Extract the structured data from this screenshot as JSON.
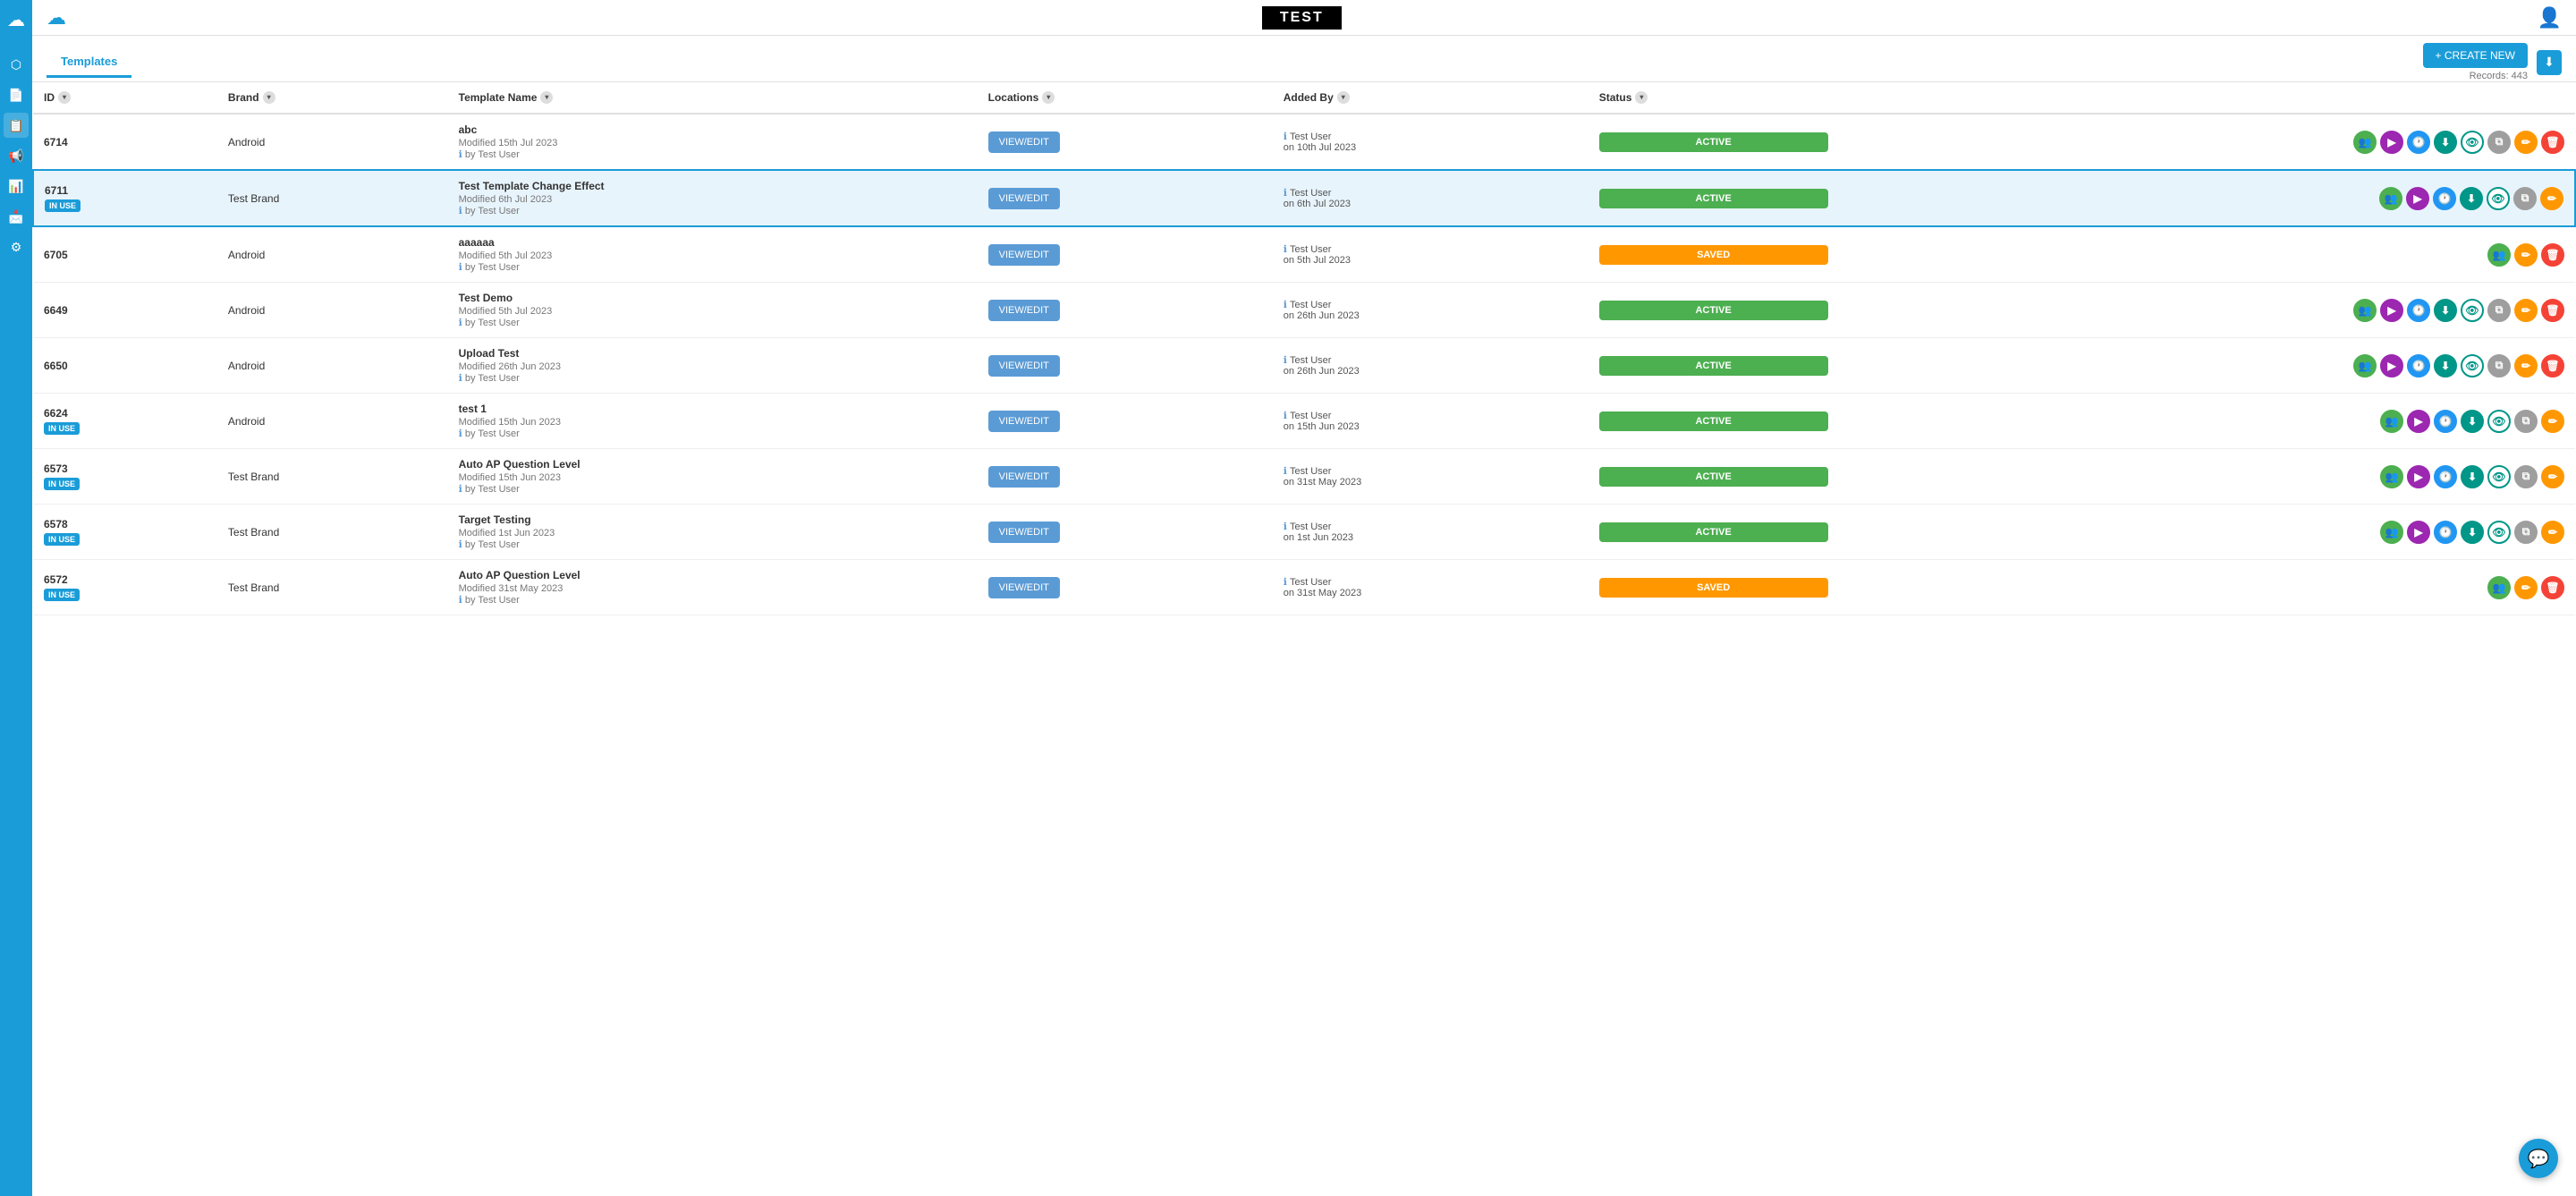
{
  "header": {
    "title": "TEST",
    "user_icon": "👤"
  },
  "tabs": {
    "active": "Templates",
    "items": [
      "Templates"
    ]
  },
  "toolbar": {
    "create_new_label": "+ CREATE NEW",
    "records_label": "Records: 443"
  },
  "table": {
    "columns": [
      {
        "label": "ID",
        "key": "id"
      },
      {
        "label": "Brand",
        "key": "brand"
      },
      {
        "label": "Template Name",
        "key": "template_name"
      },
      {
        "label": "Locations",
        "key": "locations"
      },
      {
        "label": "Added By",
        "key": "added_by"
      },
      {
        "label": "Status",
        "key": "status"
      }
    ],
    "rows": [
      {
        "id": "6714",
        "in_use": false,
        "brand": "Android",
        "template_name": "abc",
        "modified": "Modified 15th Jul 2023",
        "by": "by Test User",
        "added_by_user": "Test User",
        "added_on": "on 10th Jul 2023",
        "status": "ACTIVE",
        "highlighted": false,
        "actions": [
          "group",
          "play",
          "clock",
          "download",
          "eye",
          "copy",
          "edit",
          "delete"
        ]
      },
      {
        "id": "6711",
        "in_use": true,
        "brand": "Test Brand",
        "template_name": "Test Template Change Effect",
        "modified": "Modified 6th Jul 2023",
        "by": "by Test User",
        "added_by_user": "Test User",
        "added_on": "on 6th Jul 2023",
        "status": "ACTIVE",
        "highlighted": true,
        "actions": [
          "group",
          "play",
          "clock",
          "download",
          "eye",
          "copy",
          "edit"
        ]
      },
      {
        "id": "6705",
        "in_use": false,
        "brand": "Android",
        "template_name": "aaaaaa",
        "modified": "Modified 5th Jul 2023",
        "by": "by Test User",
        "added_by_user": "Test User",
        "added_on": "on 5th Jul 2023",
        "status": "SAVED",
        "highlighted": false,
        "actions": [
          "group",
          "edit",
          "delete"
        ]
      },
      {
        "id": "6649",
        "in_use": false,
        "brand": "Android",
        "template_name": "Test Demo",
        "modified": "Modified 5th Jul 2023",
        "by": "by Test User",
        "added_by_user": "Test User",
        "added_on": "on 26th Jun 2023",
        "status": "ACTIVE",
        "highlighted": false,
        "actions": [
          "group",
          "play",
          "clock",
          "download",
          "eye",
          "copy",
          "edit",
          "delete"
        ]
      },
      {
        "id": "6650",
        "in_use": false,
        "brand": "Android",
        "template_name": "Upload Test",
        "modified": "Modified 26th Jun 2023",
        "by": "by Test User",
        "added_by_user": "Test User",
        "added_on": "on 26th Jun 2023",
        "status": "ACTIVE",
        "highlighted": false,
        "actions": [
          "group",
          "play",
          "clock",
          "download",
          "eye",
          "copy",
          "edit",
          "delete"
        ]
      },
      {
        "id": "6624",
        "in_use": true,
        "brand": "Android",
        "template_name": "test 1",
        "modified": "Modified 15th Jun 2023",
        "by": "by Test User",
        "added_by_user": "Test User",
        "added_on": "on 15th Jun 2023",
        "status": "ACTIVE",
        "highlighted": false,
        "actions": [
          "group",
          "play",
          "clock",
          "download",
          "eye",
          "copy",
          "edit"
        ]
      },
      {
        "id": "6573",
        "in_use": true,
        "brand": "Test Brand",
        "template_name": "Auto AP Question Level",
        "modified": "Modified 15th Jun 2023",
        "by": "by Test User",
        "added_by_user": "Test User",
        "added_on": "on 31st May 2023",
        "status": "ACTIVE",
        "highlighted": false,
        "actions": [
          "group",
          "play",
          "clock",
          "download",
          "eye",
          "copy",
          "edit"
        ]
      },
      {
        "id": "6578",
        "in_use": true,
        "brand": "Test Brand",
        "template_name": "Target Testing",
        "modified": "Modified 1st Jun 2023",
        "by": "by Test User",
        "added_by_user": "Test User",
        "added_on": "on 1st Jun 2023",
        "status": "ACTIVE",
        "highlighted": false,
        "actions": [
          "group",
          "play",
          "clock",
          "download",
          "eye",
          "copy",
          "edit"
        ]
      },
      {
        "id": "6572",
        "in_use": true,
        "brand": "Test Brand",
        "template_name": "Auto AP Question Level",
        "modified": "Modified 31st May 2023",
        "by": "by Test User",
        "added_by_user": "Test User",
        "added_on": "on 31st May 2023",
        "status": "SAVED",
        "highlighted": false,
        "actions": [
          "group",
          "edit",
          "delete"
        ]
      }
    ]
  },
  "sidebar": {
    "items": [
      {
        "icon": "⬡",
        "label": "apps"
      },
      {
        "icon": "📄",
        "label": "documents"
      },
      {
        "icon": "📋",
        "label": "templates"
      },
      {
        "icon": "📢",
        "label": "campaigns"
      },
      {
        "icon": "📊",
        "label": "analytics"
      },
      {
        "icon": "📩",
        "label": "messages"
      },
      {
        "icon": "⚙",
        "label": "settings"
      }
    ]
  },
  "action_icons": {
    "group": "👥",
    "play": "▶",
    "clock": "🕐",
    "download": "⬇",
    "eye": "👁",
    "copy": "⧉",
    "edit": "✏",
    "delete": "🗑"
  },
  "view_edit_label": "VIEW/EDIT",
  "in_use_label": "IN USE"
}
